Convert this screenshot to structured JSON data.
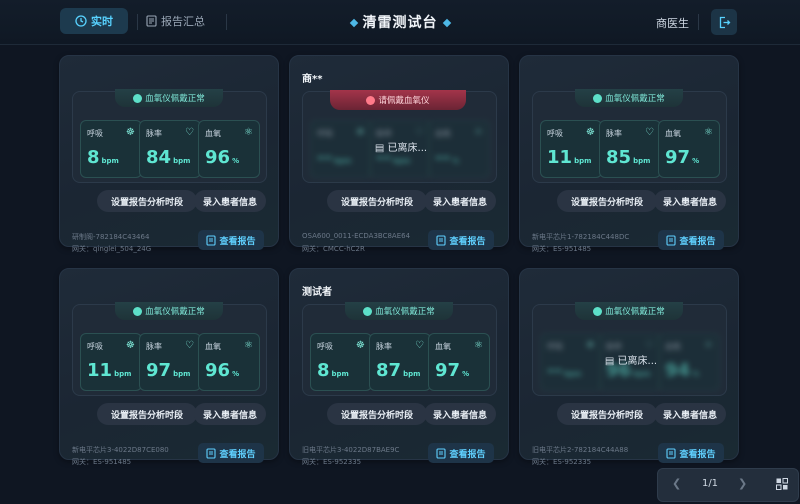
{
  "header": {
    "tab_realtime": "实时",
    "tab_reports": "报告汇总",
    "title": "清雷测试台",
    "doctor": "商医生"
  },
  "cards": [
    {
      "name": "",
      "status": "血氧仪佩戴正常",
      "alarm": false,
      "away": false,
      "vitals": [
        {
          "label": "呼吸",
          "value": "8",
          "unit": "bpm"
        },
        {
          "label": "脉率",
          "value": "84",
          "unit": "bpm"
        },
        {
          "label": "血氧",
          "value": "96",
          "unit": "%"
        }
      ],
      "device": "研制阁-782184C43464",
      "network": "网关：qinglei_504_24G"
    },
    {
      "name": "商**",
      "status": "请佩戴血氧仪",
      "alarm": true,
      "away": true,
      "away_text": "已离床...",
      "vitals": [
        {
          "label": "呼吸",
          "value": "--",
          "unit": "bpm"
        },
        {
          "label": "脉率",
          "value": "--",
          "unit": "bpm"
        },
        {
          "label": "血氧",
          "value": "--",
          "unit": "%"
        }
      ],
      "device": "OSA600_0011-ECDA3BC8AE64",
      "network": "网关：CMCC-hC2R"
    },
    {
      "name": "",
      "status": "血氧仪佩戴正常",
      "alarm": false,
      "away": false,
      "vitals": [
        {
          "label": "呼吸",
          "value": "11",
          "unit": "bpm"
        },
        {
          "label": "脉率",
          "value": "85",
          "unit": "bpm"
        },
        {
          "label": "血氧",
          "value": "97",
          "unit": "%"
        }
      ],
      "device": "新电平芯片1-782184C448DC",
      "network": "网关：ES-951485"
    },
    {
      "name": "",
      "status": "血氧仪佩戴正常",
      "alarm": false,
      "away": false,
      "vitals": [
        {
          "label": "呼吸",
          "value": "11",
          "unit": "bpm"
        },
        {
          "label": "脉率",
          "value": "97",
          "unit": "bpm"
        },
        {
          "label": "血氧",
          "value": "96",
          "unit": "%"
        }
      ],
      "device": "新电平芯片3-4022D87CE080",
      "network": "网关：ES-951485"
    },
    {
      "name": "测试者",
      "status": "血氧仪佩戴正常",
      "alarm": false,
      "away": false,
      "vitals": [
        {
          "label": "呼吸",
          "value": "8",
          "unit": "bpm"
        },
        {
          "label": "脉率",
          "value": "87",
          "unit": "bpm"
        },
        {
          "label": "血氧",
          "value": "97",
          "unit": "%"
        }
      ],
      "device": "旧电平芯片3-4022D87BAE9C",
      "network": "网关：ES-952335"
    },
    {
      "name": "",
      "status": "血氧仪佩戴正常",
      "alarm": false,
      "away": true,
      "away_text": "已离床...",
      "vitals": [
        {
          "label": "呼吸",
          "value": "--",
          "unit": "bpm"
        },
        {
          "label": "脉率",
          "value": "96",
          "unit": "bpm"
        },
        {
          "label": "血氧",
          "value": "94",
          "unit": "%"
        }
      ],
      "device": "旧电平芯片2-782184C44A88",
      "network": "网关：ES-952335"
    }
  ],
  "buttons": {
    "set_period": "设置报告分析时段",
    "enter_info": "录入患者信息",
    "view_report": "查看报告"
  },
  "pager": {
    "page": "1/1"
  }
}
